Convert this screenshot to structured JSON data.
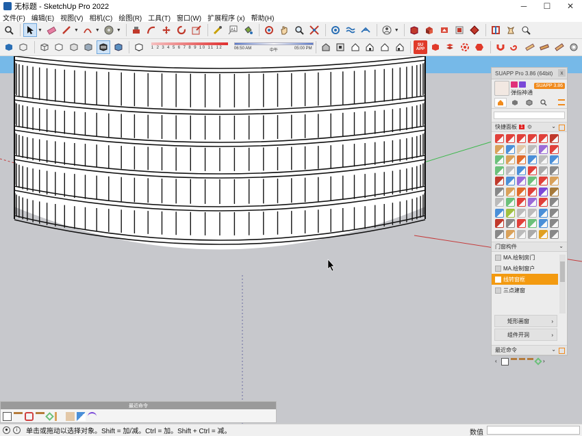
{
  "window": {
    "title": "无标题 - SketchUp Pro 2022",
    "minimize_glyph": "─",
    "maximize_glyph": "☐",
    "close_glyph": "✕"
  },
  "menu": [
    "文件(F)",
    "编辑(E)",
    "视图(V)",
    "相机(C)",
    "绘图(R)",
    "工具(T)",
    "窗口(W)",
    "扩展程序 (x)",
    "帮助(H)"
  ],
  "toolbar": {
    "shadow_months": "1 2 3 4 5 6 7 8 9 10 11 12",
    "time_start": "06:50 AM",
    "time_noon": "中午",
    "time_end": "05:00 PM",
    "su_badge": "SU APP",
    "tool_icons": [
      "search-icon",
      "select-arrow-icon",
      "eraser-icon",
      "pencil-line-icon",
      "arc-icon",
      "tape-measure-icon",
      "push-pull-icon",
      "move-icon",
      "rotate-icon",
      "scale-icon",
      "tape-icon",
      "text-icon",
      "paint-bucket-icon",
      "orbit-icon",
      "pan-icon",
      "zoom-icon",
      "zoom-extents-icon",
      "sandbox-icon",
      "account-icon"
    ]
  },
  "suapp": {
    "title": "SUAPP Pro 3.86 (64bit)",
    "version_badge": "SUAPP 3.86",
    "user_name": "弹指神通",
    "close_glyph": "x",
    "quick_panel_label": "快捷面板",
    "quick_panel_count": "1",
    "doors_section_label": "门窗构件",
    "doors_items": [
      "MA.绘制房门",
      "MA.绘制窗户",
      "线转窗框",
      "三点建窗"
    ],
    "highlighted_item": "线转窗框",
    "sub_items": [
      "矩形画窗",
      "组件开洞"
    ],
    "recent_label": "最近命令",
    "accent": "#f39a10"
  },
  "recent_panel": {
    "title": "最近命令"
  },
  "status": {
    "message": "单击或拖动以选择对象。Shift = 加/减。Ctrl = 加。Shift + Ctrl = 减。",
    "measurements_label": "数值",
    "measurements_value": ""
  }
}
